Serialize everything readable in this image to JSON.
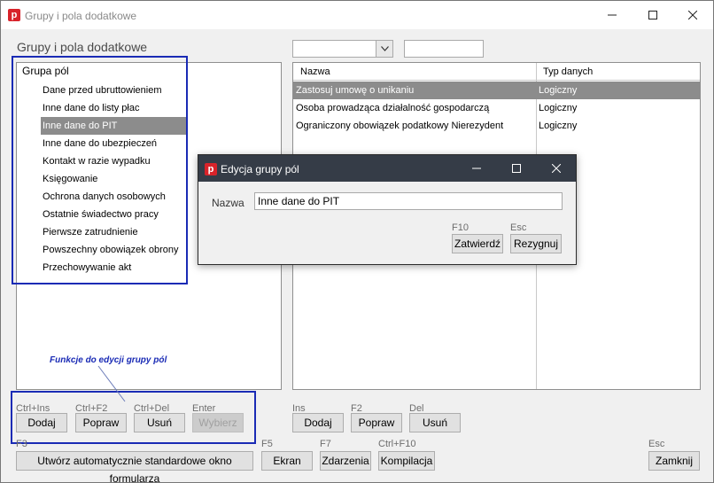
{
  "window": {
    "title": "Grupy i pola dodatkowe",
    "app_icon": "p",
    "controls": [
      "minimize-icon",
      "maximize-icon",
      "close-icon"
    ]
  },
  "section_title": "Grupy i pola dodatkowe",
  "group_list": {
    "header": "Grupa pól",
    "selected_index": 2,
    "items": [
      "Dane przed ubruttowieniem",
      "Inne dane do listy płac",
      "Inne dane do PIT",
      "Inne dane do ubezpieczeń",
      "Kontakt w razie wypadku",
      "Księgowanie",
      "Ochrona danych osobowych",
      "Ostatnie świadectwo pracy",
      "Pierwsze zatrudnienie",
      "Powszechny obowiązek obrony",
      "Przechowywanie akt"
    ]
  },
  "fields_grid": {
    "columns": [
      "Nazwa",
      "Typ danych"
    ],
    "selected_index": 0,
    "rows": [
      [
        "Zastosuj umowę o unikaniu",
        "Logiczny"
      ],
      [
        "Osoba prowadząca działalność gospodarczą",
        "Logiczny"
      ],
      [
        "Ograniczony obowiązek podatkowy Nierezydent",
        "Logiczny"
      ]
    ]
  },
  "annotation": "Funkcje do edycji grupy pól",
  "left_buttons": [
    {
      "key": "Ctrl+Ins",
      "label": "Dodaj",
      "disabled": false
    },
    {
      "key": "Ctrl+F2",
      "label": "Popraw",
      "disabled": false
    },
    {
      "key": "Ctrl+Del",
      "label": "Usuń",
      "disabled": false
    },
    {
      "key": "Enter",
      "label": "Wybierz",
      "disabled": true
    }
  ],
  "right_buttons": [
    {
      "key": "Ins",
      "label": "Dodaj"
    },
    {
      "key": "F2",
      "label": "Popraw"
    },
    {
      "key": "Del",
      "label": "Usuń"
    }
  ],
  "bottom_buttons": [
    {
      "key": "F3",
      "label": "Utwórz automatycznie standardowe okno formularza"
    },
    {
      "key": "F5",
      "label": "Ekran"
    },
    {
      "key": "F7",
      "label": "Zdarzenia"
    },
    {
      "key": "Ctrl+F10",
      "label": "Kompilacja"
    },
    {
      "key": "Esc",
      "label": "Zamknij"
    }
  ],
  "dialog": {
    "title": "Edycja grupy pól",
    "name_label": "Nazwa",
    "name_value": "Inne dane do PIT",
    "ok_key": "F10",
    "ok_label": "Zatwierdź",
    "cancel_key": "Esc",
    "cancel_label": "Rezygnuj"
  },
  "colors": {
    "selection": "#8c8c8c",
    "annotation_blue": "#1a2bb5",
    "dialog_titlebar": "#353c47",
    "app_icon_red": "#d8232a"
  }
}
